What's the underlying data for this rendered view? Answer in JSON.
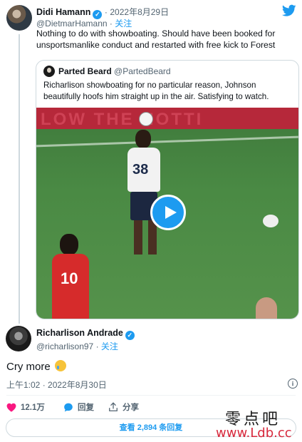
{
  "tweet1": {
    "name": "Didi Hamann",
    "verified": "✓",
    "dot": "·",
    "date": "2022年8月29日",
    "handle": "@DietmarHamann",
    "follow": "关注",
    "text": "Nothing to do with showboating. Should have been booked for unsportsmanlike conduct and restarted with free kick to Forest"
  },
  "quote": {
    "name": "Parted Beard",
    "handle": "@PartedBeard",
    "text": "Richarlison showboating for no particular reason, Johnson beautifully hoofs him straight up in the air. Satisfying to watch.",
    "video": {
      "banner_text": "LOW THE NOTTI",
      "jersey_38": "38",
      "jersey_10": "10"
    }
  },
  "tweet2": {
    "name": "Richarlison Andrade",
    "verified": "✓",
    "handle": "@richarlison97",
    "follow": "关注",
    "text": "Cry more",
    "emoji": "crying-face",
    "time": "上午1:02 · 2022年8月30日",
    "info": "i"
  },
  "actions": {
    "likes": "12.1万",
    "reply": "回复",
    "share": "分享"
  },
  "reply_button": "查看 2,894 条回复",
  "watermark": {
    "line1": "零点吧",
    "line2": "www.Ldb.cc"
  },
  "colors": {
    "accent": "#1d9bf0",
    "like": "#f91880",
    "muted": "#536471"
  },
  "icons": [
    "twitter-bird-icon",
    "verified-icon",
    "play-icon",
    "heart-icon",
    "reply-icon",
    "share-icon",
    "info-icon"
  ]
}
